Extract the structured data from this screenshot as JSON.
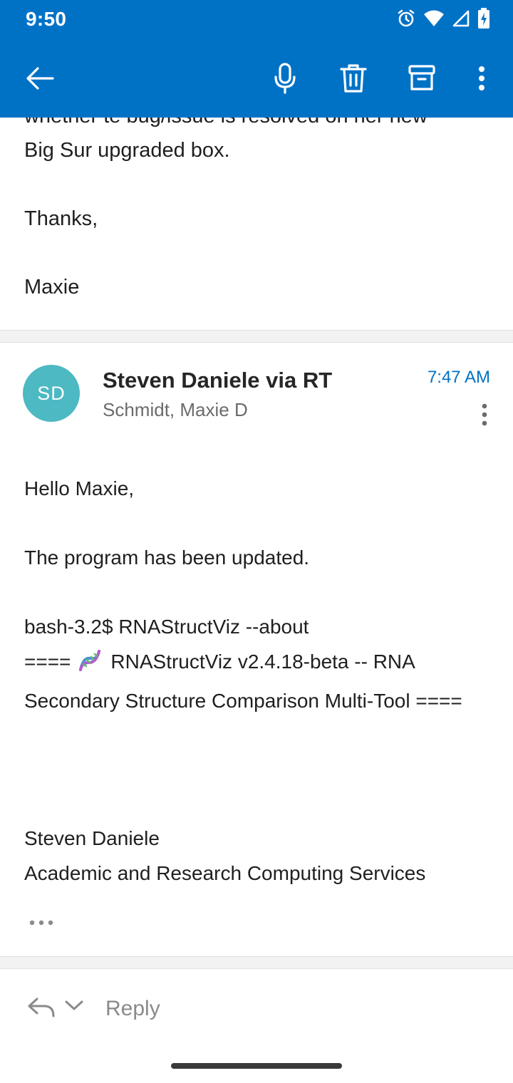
{
  "status_bar": {
    "time": "9:50",
    "icons": [
      "alarm-icon",
      "wifi-icon",
      "signal-icon",
      "battery-charging-icon"
    ]
  },
  "toolbar": {
    "icons": [
      "back-arrow-icon",
      "microphone-icon",
      "trash-icon",
      "archive-icon",
      "more-vertical-icon"
    ],
    "accent_color": "#0072c6"
  },
  "previous_message": {
    "body_lines": [
      "whether te bug/issue is resolved on her new",
      "Big Sur upgraded box.",
      "Thanks,",
      "Maxie"
    ]
  },
  "message": {
    "avatar_initials": "SD",
    "avatar_color": "#4cb9c3",
    "sender": "Steven Daniele via RT",
    "recipient": "Schmidt, Maxie D",
    "time": "7:47 AM",
    "greeting": "Hello Maxie,",
    "line_updated": "The program has been updated.",
    "command": "bash-3.2$ RNAStructViz --about",
    "about_prefix": "====",
    "about_rest": "RNAStructViz  v2.4.18-beta -- RNA",
    "about_line2": "Secondary Structure Comparison Multi-Tool ====",
    "signature_name": "Steven Daniele",
    "signature_org": "Academic and Research Computing Services",
    "show_more_icon": "ellipsis-icon"
  },
  "reply_bar": {
    "label": "Reply",
    "icons": [
      "reply-arrow-icon",
      "chevron-down-icon"
    ]
  }
}
